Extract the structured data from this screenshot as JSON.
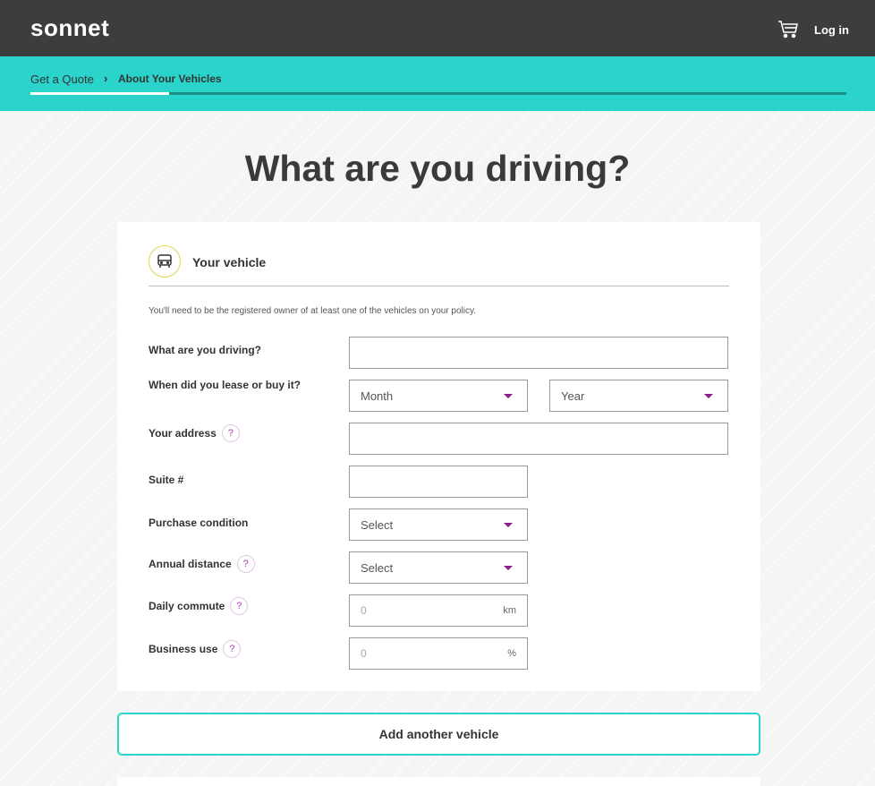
{
  "header": {
    "logo": "sonnet",
    "cart_icon": "shopping-cart-icon",
    "login_label": "Log in"
  },
  "breadcrumb": {
    "first": "Get a Quote",
    "separator": "›",
    "current": "About Your Vehicles",
    "progress_fraction": 0.17
  },
  "page": {
    "title": "What are you driving?"
  },
  "vehicle_section": {
    "icon": "car-front-icon",
    "title": "Your vehicle",
    "intro": "You'll need to be the registered owner of at least one of the vehicles on your policy.",
    "help_glyph": "?",
    "fields": {
      "vehicle": {
        "label": "What are you driving?",
        "value": ""
      },
      "lease_buy": {
        "label": "When did you lease or buy it?",
        "month": "Month",
        "year": "Year"
      },
      "address": {
        "label": "Your address",
        "value": ""
      },
      "suite": {
        "label": "Suite #",
        "value": ""
      },
      "purchase_condition": {
        "label": "Purchase condition",
        "value": "Select"
      },
      "annual_distance": {
        "label": "Annual distance",
        "value": "Select"
      },
      "daily_commute": {
        "label": "Daily commute",
        "placeholder": "0",
        "unit": "km"
      },
      "business_use": {
        "label": "Business use",
        "placeholder": "0",
        "unit": "%"
      }
    }
  },
  "actions": {
    "add_vehicle": "Add another vehicle"
  },
  "colors": {
    "header_bg": "#3d3d3d",
    "accent_teal": "#2ad4cb",
    "dropdown_caret": "#8b1a8b",
    "help_icon": "#b13cb1",
    "vehicle_icon_ring": "#e2d44a"
  }
}
